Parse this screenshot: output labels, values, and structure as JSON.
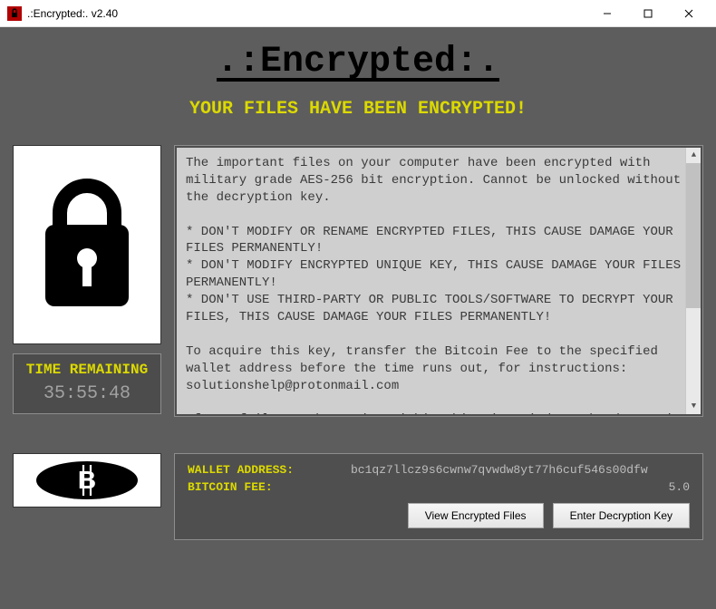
{
  "titlebar": {
    "title": ".:Encrypted:. v2.40"
  },
  "header": {
    "title": ".:Encrypted:.",
    "subtitle": "YOUR FILES HAVE BEEN ENCRYPTED!"
  },
  "timer": {
    "label": "TIME REMAINING",
    "value": "35:55:48"
  },
  "message": "The important files on your computer have been encrypted with military grade AES-256 bit encryption. Cannot be unlocked without the decryption key.\n\n* DON'T MODIFY OR RENAME ENCRYPTED FILES, THIS CAUSE DAMAGE YOUR FILES PERMANENTLY!\n* DON'T MODIFY ENCRYPTED UNIQUE KEY, THIS CAUSE DAMAGE YOUR FILES PERMANENTLY!\n* DON'T USE THIRD-PARTY OR PUBLIC TOOLS/SOFTWARE TO DECRYPT YOUR FILES, THIS CAUSE DAMAGE YOUR FILES PERMANENTLY!\n\nTo acquire this key, transfer the Bitcoin Fee to the specified wallet address before the time runs out, for instructions: solutionshelp@protonmail.com\n\nIf you fail to take action within this time window, the decryption key will be destroyed and access to your files",
  "payment": {
    "wallet_label": "WALLET ADDRESS:",
    "wallet_value": "bc1qz7llcz9s6cwnw7qvwdw8yt77h6cuf546s00dfw",
    "fee_label": "BITCOIN FEE:",
    "fee_value": "5.0"
  },
  "buttons": {
    "view_files": "View Encrypted Files",
    "enter_key": "Enter Decryption Key"
  }
}
